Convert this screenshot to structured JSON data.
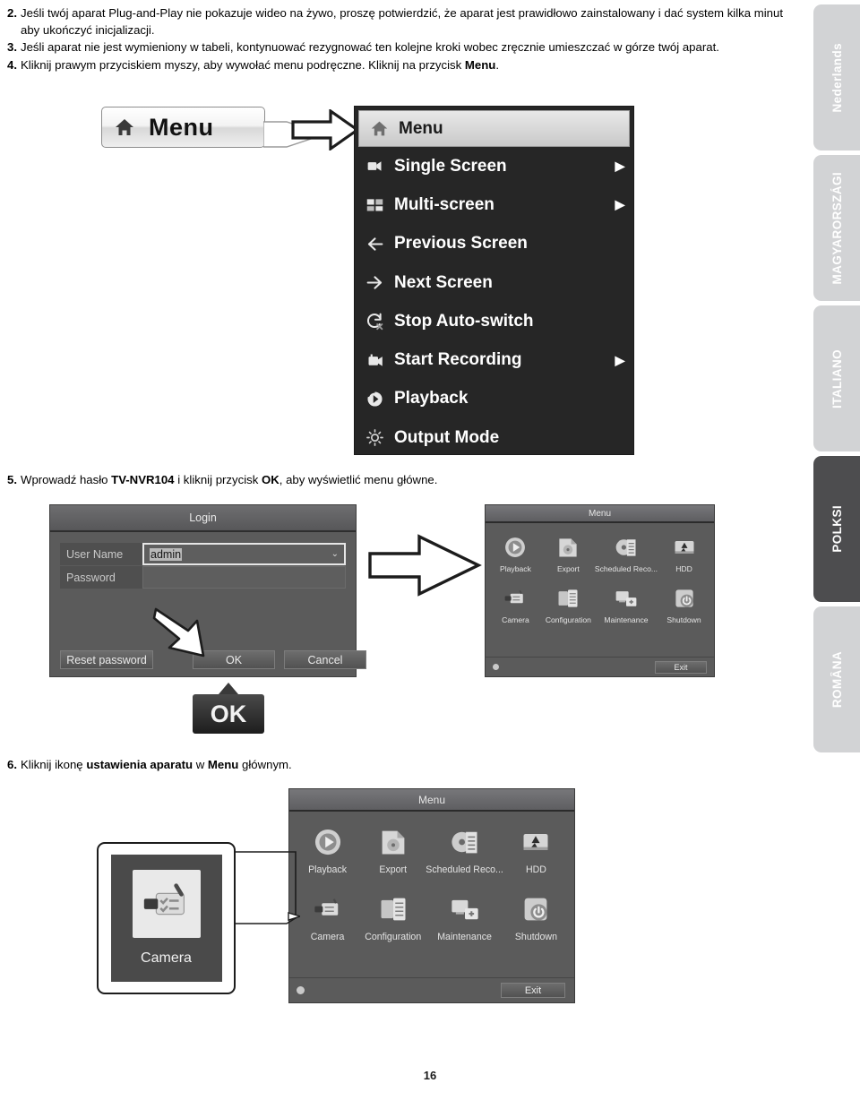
{
  "document": {
    "page_number": "16"
  },
  "language_tabs": [
    {
      "label": "Nederlands",
      "active": false
    },
    {
      "label": "MAGYARORSZÁGI",
      "active": false
    },
    {
      "label": "ITALIANO",
      "active": false
    },
    {
      "label": "POLKSI",
      "active": true
    },
    {
      "label": "ROMÂNA",
      "active": false
    }
  ],
  "steps": [
    {
      "number": "2.",
      "text": "Jeśli twój aparat Plug-and-Play nie pokazuje wideo na żywo, proszę potwierdzić, że aparat jest prawidłowo zainstalowany i dać system kilka minut aby ukończyć inicjalizacji."
    },
    {
      "number": "3.",
      "text": "Jeśli aparat nie jest wymieniony w tabeli, kontynuować rezygnować ten kolejne kroki wobec zręcznie umieszczać w górze twój aparat."
    },
    {
      "number": "4.",
      "text_a": "Kliknij prawym przyciskiem myszy, aby wywołać menu podręczne. Kliknij na przycisk ",
      "bold": "Menu",
      "text_b": "."
    },
    {
      "number": "5.",
      "text_a": "Wprowadź hasło ",
      "bold_a": "TV-NVR104",
      "text_b": " i kliknij przycisk ",
      "bold_b": "OK",
      "text_c": ", aby wyświetlić menu główne."
    },
    {
      "number": "6.",
      "text_a": "Kliknij ikonę ",
      "bold_a": "ustawienia aparatu",
      "text_b": " w ",
      "bold_b": "Menu",
      "text_c": " głównym."
    }
  ],
  "menu_button_callout": {
    "label": "Menu",
    "icon": "home-icon"
  },
  "context_menu": {
    "items": [
      {
        "label": "Menu",
        "icon": "home-icon",
        "submenu": false,
        "highlighted": true
      },
      {
        "label": "Single Screen",
        "icon": "single-screen-icon",
        "submenu": true,
        "highlighted": false
      },
      {
        "label": "Multi-screen",
        "icon": "multi-screen-icon",
        "submenu": true,
        "highlighted": false
      },
      {
        "label": "Previous Screen",
        "icon": "arrow-left-icon",
        "submenu": false,
        "highlighted": false
      },
      {
        "label": "Next Screen",
        "icon": "arrow-right-icon",
        "submenu": false,
        "highlighted": false
      },
      {
        "label": "Stop Auto-switch",
        "icon": "stop-autoswitch-icon",
        "submenu": false,
        "highlighted": false
      },
      {
        "label": "Start Recording",
        "icon": "record-icon",
        "submenu": true,
        "highlighted": false
      },
      {
        "label": "Playback",
        "icon": "playback-icon",
        "submenu": false,
        "highlighted": false
      },
      {
        "label": "Output Mode",
        "icon": "brightness-icon",
        "submenu": false,
        "highlighted": false
      }
    ],
    "submenu_arrow": "▶"
  },
  "login_dialog": {
    "title": "Login",
    "fields": [
      {
        "label": "User Name",
        "value": "admin",
        "placeholder": "",
        "dropdown": true
      },
      {
        "label": "Password",
        "value": "",
        "placeholder": "",
        "dropdown": false
      }
    ],
    "buttons": {
      "reset": "Reset password",
      "ok": "OK",
      "cancel": "Cancel"
    },
    "dropdown_caret": "⌄"
  },
  "ok_callout": {
    "label": "OK"
  },
  "nvr_menu": {
    "title": "Menu",
    "items": [
      {
        "label": "Playback",
        "icon": "playback-icon"
      },
      {
        "label": "Export",
        "icon": "export-icon"
      },
      {
        "label": "Scheduled Reco...",
        "icon": "scheduled-record-icon"
      },
      {
        "label": "HDD",
        "icon": "hdd-icon"
      },
      {
        "label": "Camera",
        "icon": "camera-icon"
      },
      {
        "label": "Configuration",
        "icon": "configuration-icon"
      },
      {
        "label": "Maintenance",
        "icon": "maintenance-icon"
      },
      {
        "label": "Shutdown",
        "icon": "shutdown-icon"
      }
    ],
    "exit_label": "Exit"
  },
  "camera_callout": {
    "label": "Camera",
    "icon": "camera-icon"
  },
  "colors": {
    "tab_inactive": "#d2d3d5",
    "tab_active": "#4d4d4f",
    "nvr_panel": "#5b5b5b",
    "context_menu_bg": "#262626",
    "text": "#000000"
  }
}
